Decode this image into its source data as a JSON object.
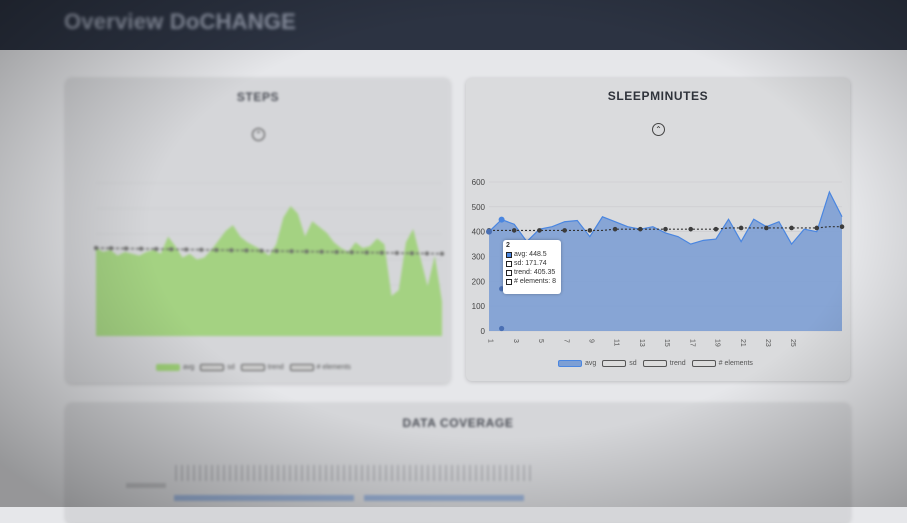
{
  "header": {
    "title": "Overview DoCHANGE"
  },
  "steps": {
    "title": "STEPS",
    "collapse_icon": "chevron-up-icon",
    "legend": [
      "avg",
      "sd",
      "trend",
      "# elements"
    ],
    "colors": {
      "area": "#9fd178",
      "trend": "#666666"
    }
  },
  "sleep": {
    "title": "SLEEPMINUTES",
    "collapse_icon": "chevron-up-icon",
    "legend": [
      "avg",
      "sd",
      "trend",
      "# elements"
    ],
    "colors": {
      "area": "#7d9fd4",
      "avg_line": "#4a86e0",
      "trend": "#333333"
    },
    "tooltip": {
      "header": "2",
      "rows": [
        {
          "label": "avg: 448.5",
          "swatch": "#4a86e0"
        },
        {
          "label": "sd: 171.74",
          "swatch": "#ffffff"
        },
        {
          "label": "trend: 405.35",
          "swatch": "#ffffff"
        },
        {
          "label": "# elements: 8",
          "swatch": "#ffffff"
        }
      ]
    }
  },
  "coverage": {
    "title": "DATA COVERAGE"
  },
  "chart_data": [
    {
      "type": "area",
      "title": "STEPS",
      "series": [
        {
          "name": "avg",
          "values": [
            0.46,
            0.44,
            0.45,
            0.42,
            0.44,
            0.43,
            0.42,
            0.44,
            0.45,
            0.43,
            0.52,
            0.47,
            0.41,
            0.43,
            0.4,
            0.41,
            0.45,
            0.5,
            0.55,
            0.58,
            0.52,
            0.49,
            0.47,
            0.45,
            0.42,
            0.48,
            0.62,
            0.68,
            0.64,
            0.52,
            0.6,
            0.57,
            0.54,
            0.49,
            0.46,
            0.44,
            0.49,
            0.46,
            0.47,
            0.51,
            0.48,
            0.21,
            0.24,
            0.49,
            0.56,
            0.41,
            0.26,
            0.42,
            0.18
          ]
        },
        {
          "name": "trend",
          "values": [
            0.46,
            0.43
          ]
        }
      ]
    },
    {
      "type": "area",
      "title": "SLEEPMINUTES",
      "ylim": [
        0,
        600
      ],
      "yticks": [
        0,
        100,
        200,
        300,
        400,
        500,
        600
      ],
      "xticks": [
        "1",
        "3",
        "5",
        "7",
        "9",
        "11",
        "13",
        "15",
        "17",
        "19",
        "21",
        "23",
        "25"
      ],
      "series": [
        {
          "name": "avg",
          "values": [
            400,
            448.5,
            430,
            360,
            410,
            420,
            440,
            445,
            380,
            460,
            440,
            420,
            410,
            420,
            395,
            380,
            350,
            365,
            370,
            450,
            360,
            450,
            420,
            440,
            350,
            410,
            400,
            560,
            460
          ]
        },
        {
          "name": "trend",
          "values": [
            405,
            405,
            405,
            405,
            405,
            405,
            405,
            405,
            405,
            405,
            410,
            410,
            410,
            410,
            410,
            410,
            410,
            410,
            410,
            415,
            415,
            415,
            415,
            415,
            415,
            415,
            415,
            420,
            420
          ]
        }
      ]
    }
  ]
}
